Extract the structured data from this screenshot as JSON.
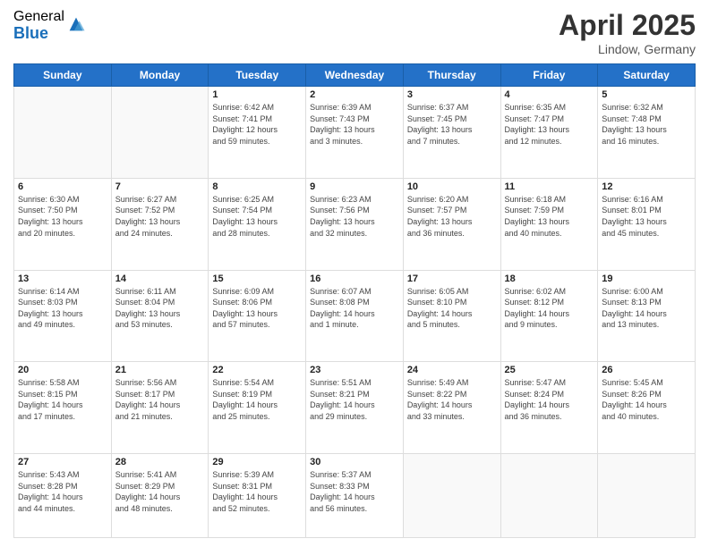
{
  "logo": {
    "general": "General",
    "blue": "Blue"
  },
  "title": "April 2025",
  "location": "Lindow, Germany",
  "days_header": [
    "Sunday",
    "Monday",
    "Tuesday",
    "Wednesday",
    "Thursday",
    "Friday",
    "Saturday"
  ],
  "weeks": [
    [
      {
        "day": "",
        "info": ""
      },
      {
        "day": "",
        "info": ""
      },
      {
        "day": "1",
        "info": "Sunrise: 6:42 AM\nSunset: 7:41 PM\nDaylight: 12 hours\nand 59 minutes."
      },
      {
        "day": "2",
        "info": "Sunrise: 6:39 AM\nSunset: 7:43 PM\nDaylight: 13 hours\nand 3 minutes."
      },
      {
        "day": "3",
        "info": "Sunrise: 6:37 AM\nSunset: 7:45 PM\nDaylight: 13 hours\nand 7 minutes."
      },
      {
        "day": "4",
        "info": "Sunrise: 6:35 AM\nSunset: 7:47 PM\nDaylight: 13 hours\nand 12 minutes."
      },
      {
        "day": "5",
        "info": "Sunrise: 6:32 AM\nSunset: 7:48 PM\nDaylight: 13 hours\nand 16 minutes."
      }
    ],
    [
      {
        "day": "6",
        "info": "Sunrise: 6:30 AM\nSunset: 7:50 PM\nDaylight: 13 hours\nand 20 minutes."
      },
      {
        "day": "7",
        "info": "Sunrise: 6:27 AM\nSunset: 7:52 PM\nDaylight: 13 hours\nand 24 minutes."
      },
      {
        "day": "8",
        "info": "Sunrise: 6:25 AM\nSunset: 7:54 PM\nDaylight: 13 hours\nand 28 minutes."
      },
      {
        "day": "9",
        "info": "Sunrise: 6:23 AM\nSunset: 7:56 PM\nDaylight: 13 hours\nand 32 minutes."
      },
      {
        "day": "10",
        "info": "Sunrise: 6:20 AM\nSunset: 7:57 PM\nDaylight: 13 hours\nand 36 minutes."
      },
      {
        "day": "11",
        "info": "Sunrise: 6:18 AM\nSunset: 7:59 PM\nDaylight: 13 hours\nand 40 minutes."
      },
      {
        "day": "12",
        "info": "Sunrise: 6:16 AM\nSunset: 8:01 PM\nDaylight: 13 hours\nand 45 minutes."
      }
    ],
    [
      {
        "day": "13",
        "info": "Sunrise: 6:14 AM\nSunset: 8:03 PM\nDaylight: 13 hours\nand 49 minutes."
      },
      {
        "day": "14",
        "info": "Sunrise: 6:11 AM\nSunset: 8:04 PM\nDaylight: 13 hours\nand 53 minutes."
      },
      {
        "day": "15",
        "info": "Sunrise: 6:09 AM\nSunset: 8:06 PM\nDaylight: 13 hours\nand 57 minutes."
      },
      {
        "day": "16",
        "info": "Sunrise: 6:07 AM\nSunset: 8:08 PM\nDaylight: 14 hours\nand 1 minute."
      },
      {
        "day": "17",
        "info": "Sunrise: 6:05 AM\nSunset: 8:10 PM\nDaylight: 14 hours\nand 5 minutes."
      },
      {
        "day": "18",
        "info": "Sunrise: 6:02 AM\nSunset: 8:12 PM\nDaylight: 14 hours\nand 9 minutes."
      },
      {
        "day": "19",
        "info": "Sunrise: 6:00 AM\nSunset: 8:13 PM\nDaylight: 14 hours\nand 13 minutes."
      }
    ],
    [
      {
        "day": "20",
        "info": "Sunrise: 5:58 AM\nSunset: 8:15 PM\nDaylight: 14 hours\nand 17 minutes."
      },
      {
        "day": "21",
        "info": "Sunrise: 5:56 AM\nSunset: 8:17 PM\nDaylight: 14 hours\nand 21 minutes."
      },
      {
        "day": "22",
        "info": "Sunrise: 5:54 AM\nSunset: 8:19 PM\nDaylight: 14 hours\nand 25 minutes."
      },
      {
        "day": "23",
        "info": "Sunrise: 5:51 AM\nSunset: 8:21 PM\nDaylight: 14 hours\nand 29 minutes."
      },
      {
        "day": "24",
        "info": "Sunrise: 5:49 AM\nSunset: 8:22 PM\nDaylight: 14 hours\nand 33 minutes."
      },
      {
        "day": "25",
        "info": "Sunrise: 5:47 AM\nSunset: 8:24 PM\nDaylight: 14 hours\nand 36 minutes."
      },
      {
        "day": "26",
        "info": "Sunrise: 5:45 AM\nSunset: 8:26 PM\nDaylight: 14 hours\nand 40 minutes."
      }
    ],
    [
      {
        "day": "27",
        "info": "Sunrise: 5:43 AM\nSunset: 8:28 PM\nDaylight: 14 hours\nand 44 minutes."
      },
      {
        "day": "28",
        "info": "Sunrise: 5:41 AM\nSunset: 8:29 PM\nDaylight: 14 hours\nand 48 minutes."
      },
      {
        "day": "29",
        "info": "Sunrise: 5:39 AM\nSunset: 8:31 PM\nDaylight: 14 hours\nand 52 minutes."
      },
      {
        "day": "30",
        "info": "Sunrise: 5:37 AM\nSunset: 8:33 PM\nDaylight: 14 hours\nand 56 minutes."
      },
      {
        "day": "",
        "info": ""
      },
      {
        "day": "",
        "info": ""
      },
      {
        "day": "",
        "info": ""
      }
    ]
  ]
}
